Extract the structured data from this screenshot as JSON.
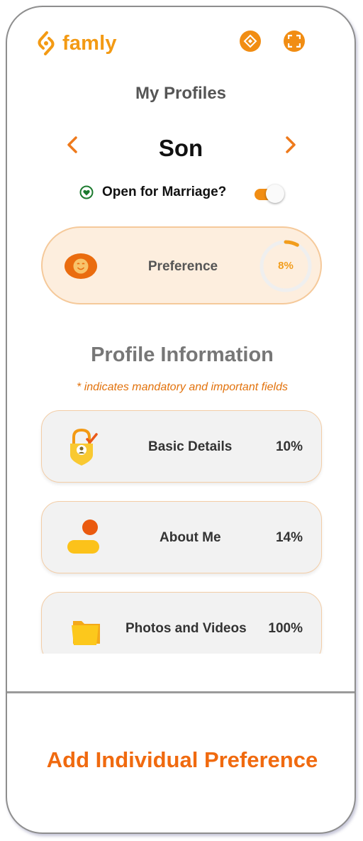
{
  "app": {
    "brand_name": "famly",
    "brand_color": "#f39a14"
  },
  "header": {
    "actions": [
      {
        "icon": "sync-diamond-icon"
      },
      {
        "icon": "scan-frame-icon"
      }
    ]
  },
  "page": {
    "title": "My Profiles"
  },
  "profile_switcher": {
    "current": "Son",
    "prev_icon": "chevron-left-icon",
    "next_icon": "chevron-right-icon"
  },
  "marriage": {
    "label": "Open for Marriage?",
    "enabled": true
  },
  "preference_card": {
    "label": "Preference",
    "percent_label": "8%",
    "progress": 0.08
  },
  "profile_information": {
    "title": "Profile Information",
    "note": "* indicates mandatory and important fields",
    "items": [
      {
        "label": "Basic Details",
        "percent": "10%",
        "icon": "lock-user-check-icon"
      },
      {
        "label": "About Me",
        "percent": "14%",
        "icon": "person-icon"
      },
      {
        "label": "Photos and Videos",
        "percent": "100%",
        "icon": "folder-icon"
      }
    ]
  },
  "footer": {
    "action_label": "Add Individual Preference",
    "accent": "#f06a0f"
  }
}
